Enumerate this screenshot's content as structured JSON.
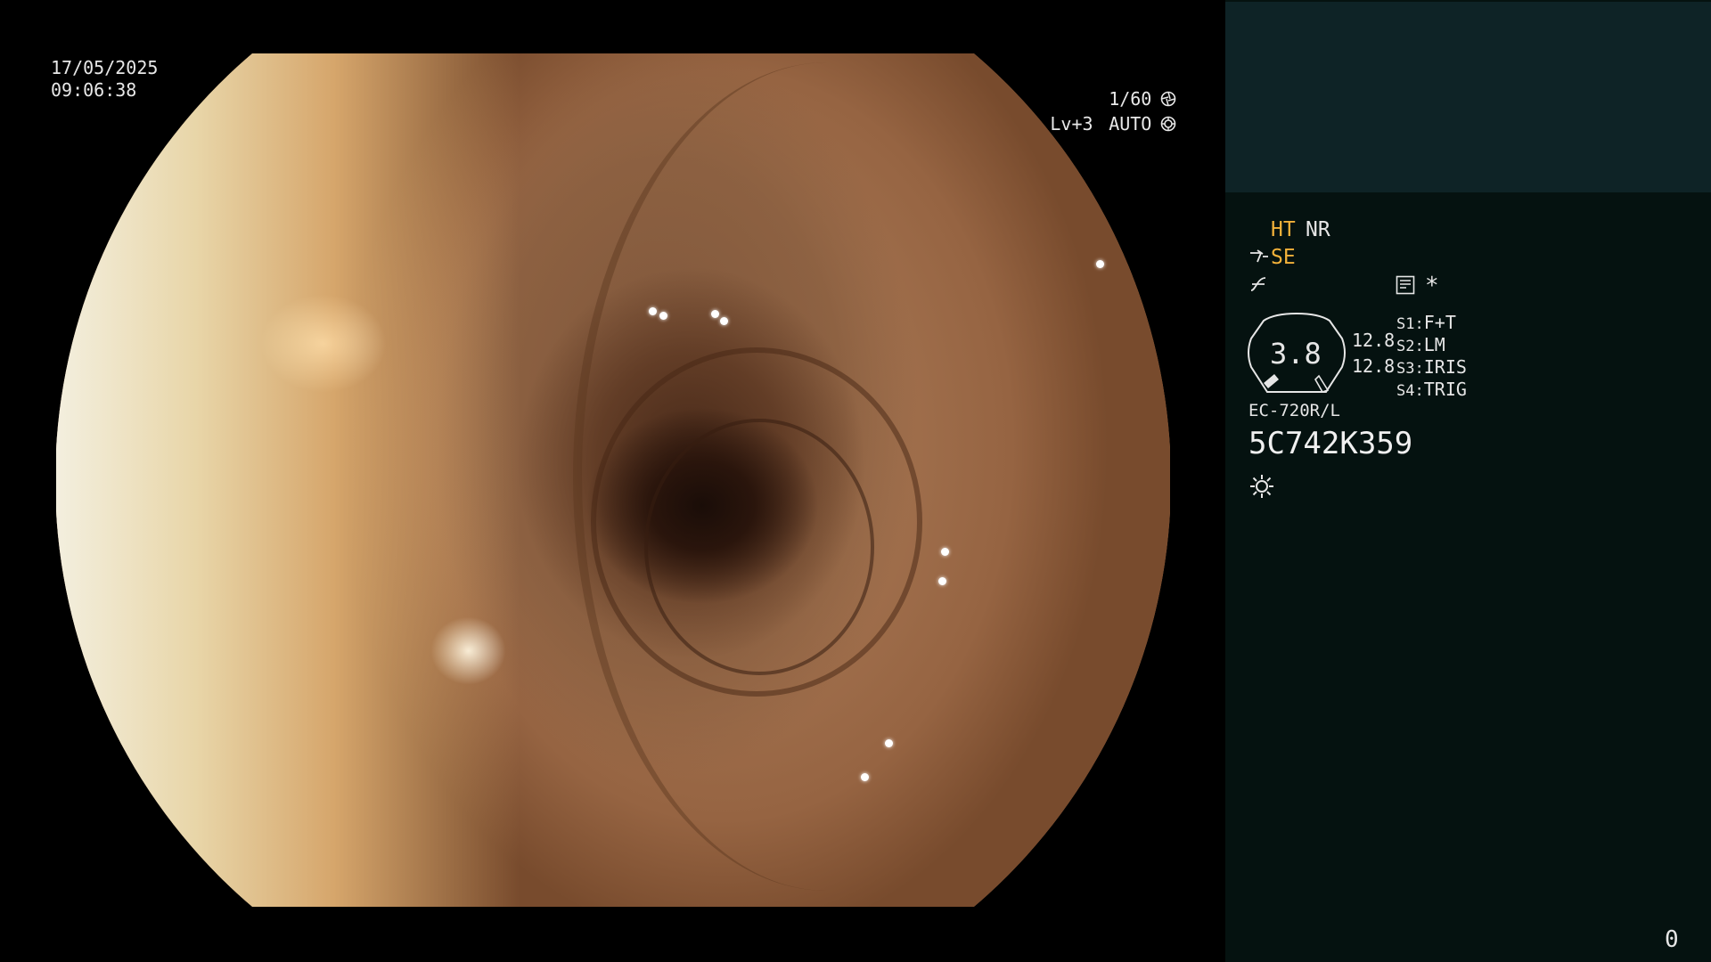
{
  "osd": {
    "date": "17/05/2025",
    "time": "09:06:38",
    "shutter": "1/60",
    "level_label": "Lv+3",
    "mode": "AUTO"
  },
  "icons": {
    "shutter_icon": "aperture-icon",
    "auto_icon": "target-icon",
    "light_icon": "sun-icon",
    "tool_icon": "scope-tool-icon",
    "enhance_icon": "curve-icon",
    "menu_icon": "keypad-icon",
    "star_icon": "asterisk-icon"
  },
  "panel": {
    "ht": "HT",
    "nr": "NR",
    "se": "SE",
    "asterisk": "*",
    "zoom": "3.8",
    "value_top": "12.8",
    "value_bottom": "12.8",
    "switches": [
      {
        "key": "S1",
        "value": "F+T"
      },
      {
        "key": "S2",
        "value": "LM"
      },
      {
        "key": "S3",
        "value": "IRIS"
      },
      {
        "key": "S4",
        "value": "TRIG"
      }
    ],
    "scope_model": "EC-720R/L",
    "serial": "5C742K359",
    "counter": "0"
  },
  "colors": {
    "accent": "#f3b23a",
    "panel_bg": "#051210",
    "thumb_bg": "#0e2326"
  }
}
